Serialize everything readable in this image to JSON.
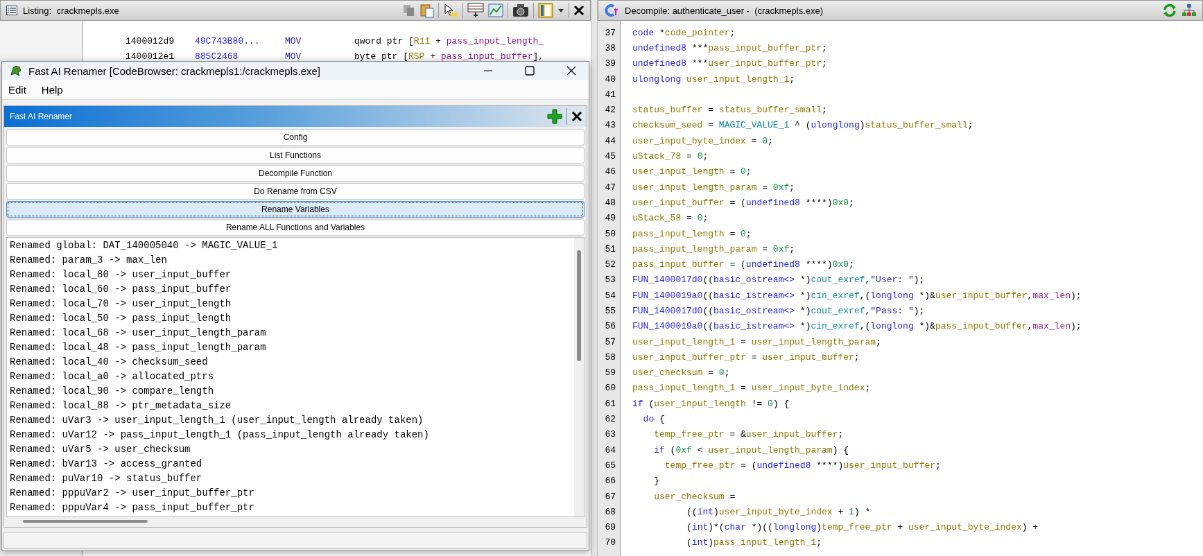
{
  "listing": {
    "title": "Listing:  crackmepls.exe",
    "rows": [
      {
        "address": "1400012d9",
        "bytes": "49C743B80...",
        "mnemonic": "MOV",
        "operands": [
          {
            "kind": "op",
            "text": "qword ptr ["
          },
          {
            "kind": "reg",
            "text": "R11"
          },
          {
            "kind": "op",
            "text": " + "
          },
          {
            "kind": "param",
            "text": "pass_input_length_"
          }
        ]
      },
      {
        "address": "1400012e1",
        "bytes": "885C2468",
        "mnemonic": "MOV",
        "operands": [
          {
            "kind": "op",
            "text": "byte ptr ["
          },
          {
            "kind": "reg",
            "text": "RSP"
          },
          {
            "kind": "op",
            "text": " + "
          },
          {
            "kind": "param",
            "text": "pass_input_buffer"
          },
          {
            "kind": "op",
            "text": "],"
          }
        ]
      }
    ]
  },
  "renamer_window": {
    "title": "Fast AI Renamer [CodeBrowser: crackmepls1:/crackmepls.exe]",
    "menu": [
      "Edit",
      "Help"
    ],
    "panel_title": "Fast AI Renamer",
    "buttons": [
      {
        "label": "Config",
        "selected": false
      },
      {
        "label": "List Functions",
        "selected": false
      },
      {
        "label": "Decompile Function",
        "selected": false
      },
      {
        "label": "Do Rename from CSV",
        "selected": false
      },
      {
        "label": "Rename Variables",
        "selected": true
      },
      {
        "label": "Rename ALL Functions and Variables",
        "selected": false
      }
    ],
    "log": [
      "Renamed global: DAT_140005040 -> MAGIC_VALUE_1",
      "Renamed: param_3 -> max_len",
      "Renamed: local_80 -> user_input_buffer",
      "Renamed: local_60 -> pass_input_buffer",
      "Renamed: local_70 -> user_input_length",
      "Renamed: local_50 -> pass_input_length",
      "Renamed: local_68 -> user_input_length_param",
      "Renamed: local_48 -> pass_input_length_param",
      "Renamed: local_40 -> checksum_seed",
      "Renamed: local_a0 -> allocated_ptrs",
      "Renamed: local_90 -> compare_length",
      "Renamed: local_88 -> ptr_metadata_size",
      "Renamed: uVar3 -> user_input_length_1 (user_input_length already taken)",
      "Renamed: uVar12 -> pass_input_length_1 (pass_input_length already taken)",
      "Renamed: uVar5 -> user_checksum",
      "Renamed: bVar13 -> access_granted",
      "Renamed: puVar10 -> status_buffer",
      "Renamed: pppuVar2 -> user_input_buffer_ptr",
      "Renamed: pppuVar4 -> pass_input_buffer_ptr"
    ]
  },
  "decompile": {
    "title": "Decompile: authenticate_user -  (crackmepls.exe)",
    "lines": [
      {
        "number": "37",
        "tokens": [
          {
            "kind": "type",
            "text": "code"
          },
          {
            "kind": "op",
            "text": " *"
          },
          {
            "kind": "var",
            "text": "code_pointer"
          },
          {
            "kind": "op",
            "text": ";"
          }
        ]
      },
      {
        "number": "38",
        "tokens": [
          {
            "kind": "type",
            "text": "undefined8"
          },
          {
            "kind": "op",
            "text": " ***"
          },
          {
            "kind": "var",
            "text": "pass_input_buffer_ptr"
          },
          {
            "kind": "op",
            "text": ";"
          }
        ]
      },
      {
        "number": "39",
        "tokens": [
          {
            "kind": "type",
            "text": "undefined8"
          },
          {
            "kind": "op",
            "text": " ***"
          },
          {
            "kind": "var",
            "text": "user_input_buffer_ptr"
          },
          {
            "kind": "op",
            "text": ";"
          }
        ]
      },
      {
        "number": "40",
        "tokens": [
          {
            "kind": "type",
            "text": "ulonglong"
          },
          {
            "kind": "var",
            "text": " user_input_length_1"
          },
          {
            "kind": "op",
            "text": ";"
          }
        ]
      },
      {
        "number": "41"
      },
      {
        "number": "42",
        "tokens": [
          {
            "kind": "var",
            "text": "status_buffer"
          },
          {
            "kind": "op",
            "text": " = "
          },
          {
            "kind": "var",
            "text": "status_buffer_small"
          },
          {
            "kind": "op",
            "text": ";"
          }
        ]
      },
      {
        "number": "43",
        "tokens": [
          {
            "kind": "var",
            "text": "checksum_seed"
          },
          {
            "kind": "op",
            "text": " = "
          },
          {
            "kind": "global",
            "text": "MAGIC_VALUE_1"
          },
          {
            "kind": "op",
            "text": " ^ ("
          },
          {
            "kind": "type",
            "text": "ulonglong"
          },
          {
            "kind": "op",
            "text": ")"
          },
          {
            "kind": "var",
            "text": "status_buffer_small"
          },
          {
            "kind": "op",
            "text": ";"
          }
        ]
      },
      {
        "number": "44",
        "tokens": [
          {
            "kind": "var",
            "text": "user_input_byte_index"
          },
          {
            "kind": "op",
            "text": " = "
          },
          {
            "kind": "num",
            "text": "0"
          },
          {
            "kind": "op",
            "text": ";"
          }
        ]
      },
      {
        "number": "45",
        "tokens": [
          {
            "kind": "var",
            "text": "uStack_78"
          },
          {
            "kind": "op",
            "text": " = "
          },
          {
            "kind": "num",
            "text": "0"
          },
          {
            "kind": "op",
            "text": ";"
          }
        ]
      },
      {
        "number": "46",
        "tokens": [
          {
            "kind": "var",
            "text": "user_input_length"
          },
          {
            "kind": "op",
            "text": " = "
          },
          {
            "kind": "num",
            "text": "0"
          },
          {
            "kind": "op",
            "text": ";"
          }
        ]
      },
      {
        "number": "47",
        "tokens": [
          {
            "kind": "var",
            "text": "user_input_length_param"
          },
          {
            "kind": "op",
            "text": " = "
          },
          {
            "kind": "num",
            "text": "0xf"
          },
          {
            "kind": "op",
            "text": ";"
          }
        ]
      },
      {
        "number": "48",
        "tokens": [
          {
            "kind": "var",
            "text": "user_input_buffer"
          },
          {
            "kind": "op",
            "text": " = ("
          },
          {
            "kind": "type",
            "text": "undefined8"
          },
          {
            "kind": "op",
            "text": " ****)"
          },
          {
            "kind": "num",
            "text": "0x0"
          },
          {
            "kind": "op",
            "text": ";"
          }
        ]
      },
      {
        "number": "49",
        "tokens": [
          {
            "kind": "var",
            "text": "uStack_58"
          },
          {
            "kind": "op",
            "text": " = "
          },
          {
            "kind": "num",
            "text": "0"
          },
          {
            "kind": "op",
            "text": ";"
          }
        ]
      },
      {
        "number": "50",
        "tokens": [
          {
            "kind": "var",
            "text": "pass_input_length"
          },
          {
            "kind": "op",
            "text": " = "
          },
          {
            "kind": "num",
            "text": "0"
          },
          {
            "kind": "op",
            "text": ";"
          }
        ]
      },
      {
        "number": "51",
        "tokens": [
          {
            "kind": "var",
            "text": "pass_input_length_param"
          },
          {
            "kind": "op",
            "text": " = "
          },
          {
            "kind": "num",
            "text": "0xf"
          },
          {
            "kind": "op",
            "text": ";"
          }
        ]
      },
      {
        "number": "52",
        "tokens": [
          {
            "kind": "var",
            "text": "pass_input_buffer"
          },
          {
            "kind": "op",
            "text": " = ("
          },
          {
            "kind": "type",
            "text": "undefined8"
          },
          {
            "kind": "op",
            "text": " ****)"
          },
          {
            "kind": "num",
            "text": "0x0"
          },
          {
            "kind": "op",
            "text": ";"
          }
        ]
      },
      {
        "number": "53",
        "tokens": [
          {
            "kind": "func",
            "text": "FUN_1400017d0"
          },
          {
            "kind": "op",
            "text": "(("
          },
          {
            "kind": "type",
            "text": "basic_ostream<>"
          },
          {
            "kind": "op",
            "text": " *)"
          },
          {
            "kind": "global",
            "text": "cout_exref"
          },
          {
            "kind": "op",
            "text": ","
          },
          {
            "kind": "str",
            "text": "\"User: \""
          },
          {
            "kind": "op",
            "text": ");"
          }
        ]
      },
      {
        "number": "54",
        "tokens": [
          {
            "kind": "func",
            "text": "FUN_1400019a0"
          },
          {
            "kind": "op",
            "text": "(("
          },
          {
            "kind": "type",
            "text": "basic_istream<>"
          },
          {
            "kind": "op",
            "text": " *)"
          },
          {
            "kind": "global",
            "text": "cin_exref"
          },
          {
            "kind": "op",
            "text": ",("
          },
          {
            "kind": "type",
            "text": "longlong"
          },
          {
            "kind": "op",
            "text": " *)&"
          },
          {
            "kind": "var",
            "text": "user_input_buffer"
          },
          {
            "kind": "op",
            "text": ","
          },
          {
            "kind": "param",
            "text": "max_len"
          },
          {
            "kind": "op",
            "text": ");"
          }
        ]
      },
      {
        "number": "55",
        "tokens": [
          {
            "kind": "func",
            "text": "FUN_1400017d0"
          },
          {
            "kind": "op",
            "text": "(("
          },
          {
            "kind": "type",
            "text": "basic_ostream<>"
          },
          {
            "kind": "op",
            "text": " *)"
          },
          {
            "kind": "global",
            "text": "cout_exref"
          },
          {
            "kind": "op",
            "text": ","
          },
          {
            "kind": "str",
            "text": "\"Pass: \""
          },
          {
            "kind": "op",
            "text": ");"
          }
        ]
      },
      {
        "number": "56",
        "tokens": [
          {
            "kind": "func",
            "text": "FUN_1400019a0"
          },
          {
            "kind": "op",
            "text": "(("
          },
          {
            "kind": "type",
            "text": "basic_istream<>"
          },
          {
            "kind": "op",
            "text": " *)"
          },
          {
            "kind": "global",
            "text": "cin_exref"
          },
          {
            "kind": "op",
            "text": ",("
          },
          {
            "kind": "type",
            "text": "longlong"
          },
          {
            "kind": "op",
            "text": " *)&"
          },
          {
            "kind": "var",
            "text": "pass_input_buffer"
          },
          {
            "kind": "op",
            "text": ","
          },
          {
            "kind": "param",
            "text": "max_len"
          },
          {
            "kind": "op",
            "text": ");"
          }
        ]
      },
      {
        "number": "57",
        "tokens": [
          {
            "kind": "var",
            "text": "user_input_length_1"
          },
          {
            "kind": "op",
            "text": " = "
          },
          {
            "kind": "var",
            "text": "user_input_length_param"
          },
          {
            "kind": "op",
            "text": ";"
          }
        ]
      },
      {
        "number": "58",
        "tokens": [
          {
            "kind": "var",
            "text": "user_input_buffer_ptr"
          },
          {
            "kind": "op",
            "text": " = "
          },
          {
            "kind": "var",
            "text": "user_input_buffer"
          },
          {
            "kind": "op",
            "text": ";"
          }
        ]
      },
      {
        "number": "59",
        "tokens": [
          {
            "kind": "var",
            "text": "user_checksum"
          },
          {
            "kind": "op",
            "text": " = "
          },
          {
            "kind": "num",
            "text": "0"
          },
          {
            "kind": "op",
            "text": ";"
          }
        ]
      },
      {
        "number": "60",
        "tokens": [
          {
            "kind": "var",
            "text": "pass_input_length_1"
          },
          {
            "kind": "op",
            "text": " = "
          },
          {
            "kind": "var",
            "text": "user_input_byte_index"
          },
          {
            "kind": "op",
            "text": ";"
          }
        ]
      },
      {
        "number": "61",
        "tokens": [
          {
            "kind": "type",
            "text": "if"
          },
          {
            "kind": "op",
            "text": " ("
          },
          {
            "kind": "var",
            "text": "user_input_length"
          },
          {
            "kind": "op",
            "text": " != "
          },
          {
            "kind": "num",
            "text": "0"
          },
          {
            "kind": "op",
            "text": ") {"
          }
        ]
      },
      {
        "number": "62",
        "tokens": [
          {
            "kind": "type",
            "text": "  do"
          },
          {
            "kind": "op",
            "text": " {"
          }
        ]
      },
      {
        "number": "63",
        "tokens": [
          {
            "kind": "var",
            "text": "    temp_free_ptr"
          },
          {
            "kind": "op",
            "text": " = &"
          },
          {
            "kind": "var",
            "text": "user_input_buffer"
          },
          {
            "kind": "op",
            "text": ";"
          }
        ]
      },
      {
        "number": "64",
        "tokens": [
          {
            "kind": "type",
            "text": "    if"
          },
          {
            "kind": "op",
            "text": " ("
          },
          {
            "kind": "num",
            "text": "0xf"
          },
          {
            "kind": "op",
            "text": " < "
          },
          {
            "kind": "var",
            "text": "user_input_length_param"
          },
          {
            "kind": "op",
            "text": ") {"
          }
        ]
      },
      {
        "number": "65",
        "tokens": [
          {
            "kind": "var",
            "text": "      temp_free_ptr"
          },
          {
            "kind": "op",
            "text": " = ("
          },
          {
            "kind": "type",
            "text": "undefined8"
          },
          {
            "kind": "op",
            "text": " ****)"
          },
          {
            "kind": "var",
            "text": "user_input_buffer"
          },
          {
            "kind": "op",
            "text": ";"
          }
        ]
      },
      {
        "number": "66",
        "tokens": [
          {
            "kind": "op",
            "text": "    }"
          }
        ]
      },
      {
        "number": "67",
        "tokens": [
          {
            "kind": "var",
            "text": "    user_checksum"
          },
          {
            "kind": "op",
            "text": " ="
          }
        ]
      },
      {
        "number": "68",
        "tokens": [
          {
            "kind": "op",
            "text": "          (("
          },
          {
            "kind": "type",
            "text": "int"
          },
          {
            "kind": "op",
            "text": ")"
          },
          {
            "kind": "var",
            "text": "user_input_byte_index"
          },
          {
            "kind": "op",
            "text": " + "
          },
          {
            "kind": "num",
            "text": "1"
          },
          {
            "kind": "op",
            "text": ") *"
          }
        ]
      },
      {
        "number": "69",
        "tokens": [
          {
            "kind": "op",
            "text": "          ("
          },
          {
            "kind": "type",
            "text": "int"
          },
          {
            "kind": "op",
            "text": ")*("
          },
          {
            "kind": "type",
            "text": "char"
          },
          {
            "kind": "op",
            "text": " *)(("
          },
          {
            "kind": "type",
            "text": "longlong"
          },
          {
            "kind": "op",
            "text": ")"
          },
          {
            "kind": "var",
            "text": "temp_free_ptr"
          },
          {
            "kind": "op",
            "text": " + "
          },
          {
            "kind": "var",
            "text": "user_input_byte_index"
          },
          {
            "kind": "op",
            "text": ") +"
          }
        ]
      },
      {
        "number": "70",
        "tokens": [
          {
            "kind": "op",
            "text": "          ("
          },
          {
            "kind": "type",
            "text": "int"
          },
          {
            "kind": "op",
            "text": ")"
          },
          {
            "kind": "var",
            "text": "pass_input_length_1"
          },
          {
            "kind": "op",
            "text": ";"
          }
        ]
      }
    ]
  }
}
